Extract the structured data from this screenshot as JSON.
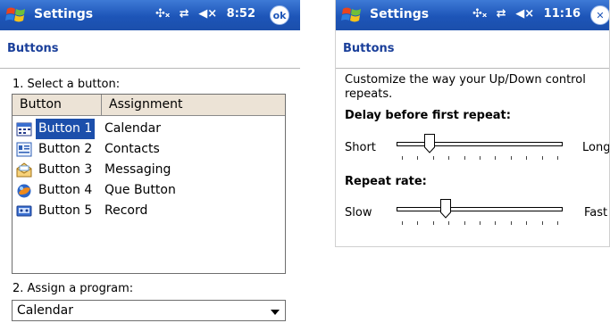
{
  "left": {
    "title": "Settings",
    "time": "8:52",
    "ok_label": "ok",
    "heading": "Buttons",
    "step1": "1. Select a button:",
    "columns": [
      "Button",
      "Assignment"
    ],
    "rows": [
      {
        "button": "Button 1",
        "assignment": "Calendar",
        "icon": "calendar-icon",
        "selected": true
      },
      {
        "button": "Button 2",
        "assignment": "Contacts",
        "icon": "contacts-icon",
        "selected": false
      },
      {
        "button": "Button 3",
        "assignment": "Messaging",
        "icon": "messaging-icon",
        "selected": false
      },
      {
        "button": "Button 4",
        "assignment": "Que Button",
        "icon": "que-button-icon",
        "selected": false
      },
      {
        "button": "Button 5",
        "assignment": "Record",
        "icon": "record-icon",
        "selected": false
      }
    ],
    "step2": "2. Assign a program:",
    "program_value": "Calendar"
  },
  "right": {
    "title": "Settings",
    "time": "11:16",
    "heading": "Buttons",
    "description_line1": "Customize the way your Up/Down control",
    "description_line2": "repeats.",
    "delay_label": "Delay before first repeat:",
    "delay_min": "Short",
    "delay_max": "Long",
    "delay_position": 0.18,
    "rate_label": "Repeat rate:",
    "rate_min": "Slow",
    "rate_max": "Fast",
    "rate_position": 0.28
  },
  "colors": {
    "titlebar": "#1d55b8",
    "selection": "#1c4fab",
    "heading_text": "#1a3f9a",
    "header_row": "#ece3d6"
  }
}
